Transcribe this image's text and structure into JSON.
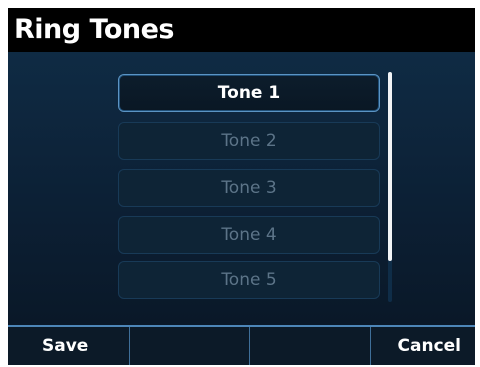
{
  "header": {
    "title": "Ring Tones"
  },
  "tones": [
    {
      "label": "Tone 1",
      "selected": true
    },
    {
      "label": "Tone 2",
      "selected": false
    },
    {
      "label": "Tone 3",
      "selected": false
    },
    {
      "label": "Tone 4",
      "selected": false
    },
    {
      "label": "Tone 5",
      "selected": false
    }
  ],
  "softkeys": [
    {
      "label": "Save"
    },
    {
      "label": ""
    },
    {
      "label": ""
    },
    {
      "label": "Cancel"
    }
  ],
  "scrollbar": {
    "visible_fraction": 0.82,
    "position_fraction": 0.0
  },
  "colors": {
    "accent": "#5b94c4",
    "selected_text": "#ffffff",
    "unselected_text": "#5c7488",
    "title_bar": "#000000"
  }
}
